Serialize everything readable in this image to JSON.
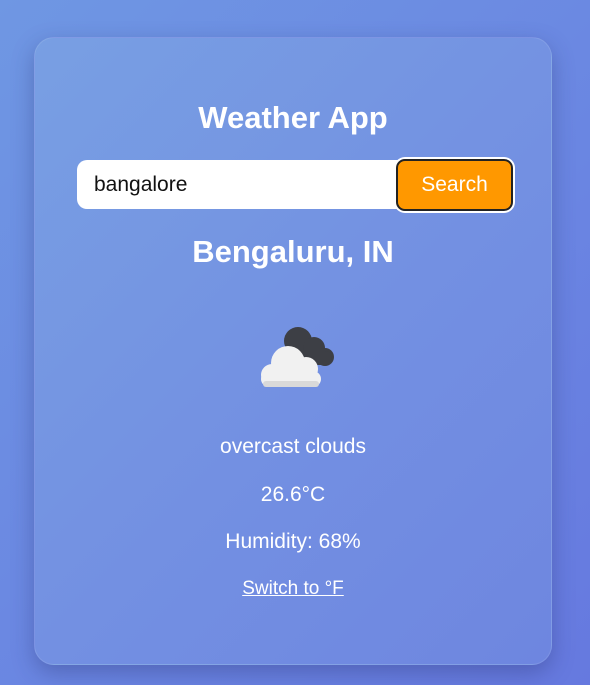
{
  "app": {
    "title": "Weather App"
  },
  "search": {
    "value": "bangalore",
    "button_label": "Search"
  },
  "weather": {
    "location": "Bengaluru, IN",
    "icon": "overcast-clouds-icon",
    "description": "overcast clouds",
    "temperature": "26.6°C",
    "humidity": "Humidity: 68%"
  },
  "units": {
    "toggle_label": "Switch to °F"
  },
  "colors": {
    "background": "#6a85e2",
    "card": "#7390e2",
    "accent": "#ff9800",
    "text": "#ffffff"
  }
}
